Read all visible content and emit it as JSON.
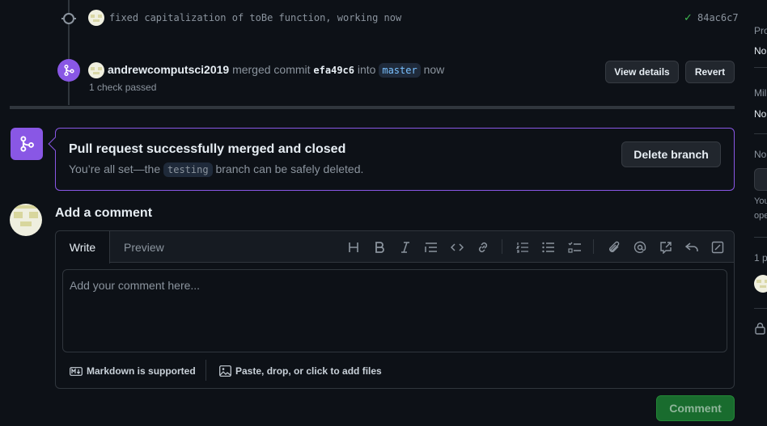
{
  "timeline": {
    "commit": {
      "message": "fixed capitalization of toBe function, working now",
      "sha": "84ac6c7"
    },
    "merge_event": {
      "user": "andrewcomputsci2019",
      "action": "merged commit",
      "commit": "efa49c6",
      "into": "into",
      "branch": "master",
      "time": "now",
      "checks": "1 check passed",
      "view_details_label": "View details",
      "revert_label": "Revert"
    }
  },
  "merged_box": {
    "title": "Pull request successfully merged and closed",
    "sub_before": "You’re all set—the",
    "branch": "testing",
    "sub_after": "branch can be safely deleted.",
    "delete_branch_label": "Delete branch"
  },
  "comment": {
    "heading": "Add a comment",
    "tabs": {
      "write": "Write",
      "preview": "Preview"
    },
    "placeholder": "Add your comment here...",
    "markdown_note": "Markdown is supported",
    "attach_note": "Paste, drop, or click to add files",
    "submit_label": "Comment"
  },
  "sidebar": {
    "projects_heading": "Pro",
    "projects_value": "No",
    "milestone_heading": "Mil",
    "milestone_value": "No",
    "notifications_heading": "No",
    "notif_text_1": "You",
    "notif_text_2": "ope",
    "participants_heading": "1 p"
  },
  "colors": {
    "background": "#0d1117",
    "merged_purple": "#8957e5",
    "success_green": "#3fb950",
    "comment_button": "#196c2e"
  },
  "icons": {
    "commit": "git-commit-icon",
    "merge": "git-merge-icon",
    "check": "check-icon",
    "lock": "lock-icon",
    "markdown": "markdown-icon",
    "image": "image-icon"
  }
}
